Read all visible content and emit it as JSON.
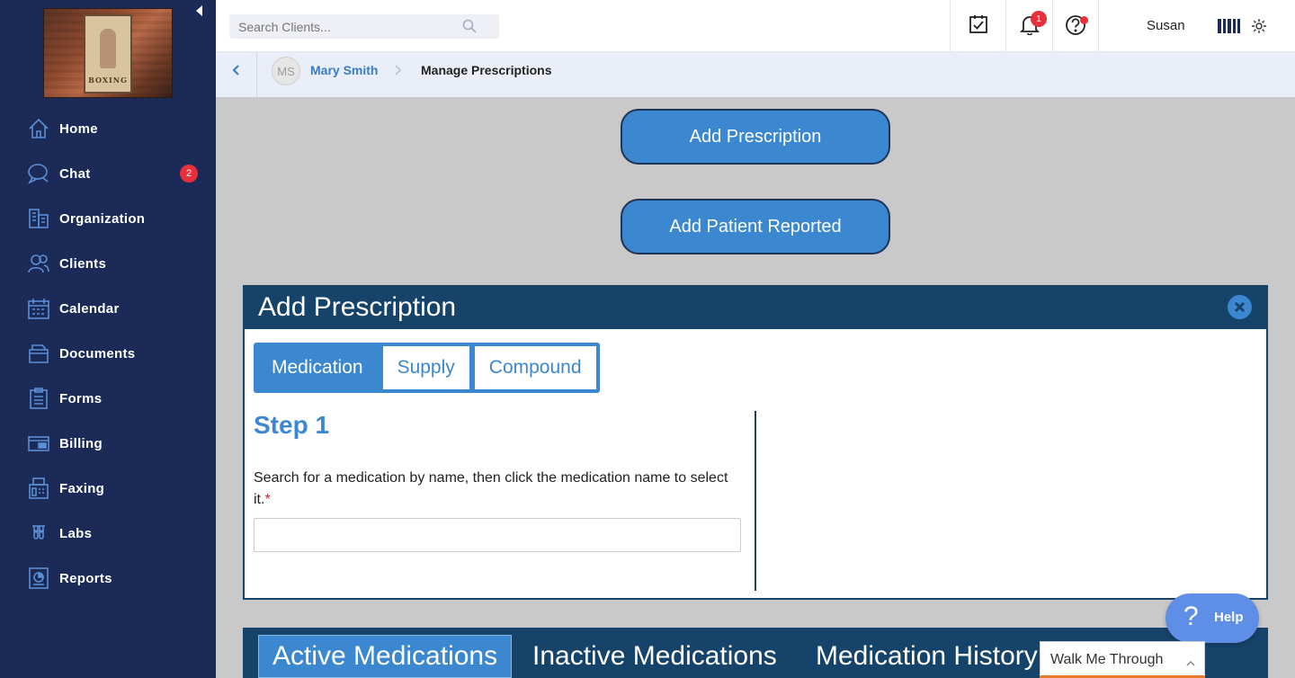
{
  "sidebar": {
    "logo_text": "BOXING",
    "items": [
      {
        "label": "Home",
        "icon": "home-icon"
      },
      {
        "label": "Chat",
        "icon": "chat-icon",
        "badge": "2"
      },
      {
        "label": "Organization",
        "icon": "organization-icon"
      },
      {
        "label": "Clients",
        "icon": "clients-icon"
      },
      {
        "label": "Calendar",
        "icon": "calendar-icon"
      },
      {
        "label": "Documents",
        "icon": "documents-icon"
      },
      {
        "label": "Forms",
        "icon": "forms-icon"
      },
      {
        "label": "Billing",
        "icon": "billing-icon"
      },
      {
        "label": "Faxing",
        "icon": "faxing-icon"
      },
      {
        "label": "Labs",
        "icon": "labs-icon"
      },
      {
        "label": "Reports",
        "icon": "reports-icon"
      }
    ]
  },
  "topbar": {
    "search_placeholder": "Search Clients...",
    "notifications_count": "1",
    "user_name": "Susan"
  },
  "breadcrumb": {
    "avatar_initials": "MS",
    "client_name": "Mary Smith",
    "page": "Manage Prescriptions"
  },
  "actions": {
    "add_prescription": "Add Prescription",
    "add_patient_reported": "Add Patient Reported"
  },
  "modal": {
    "title": "Add Prescription",
    "tabs": [
      "Medication",
      "Supply",
      "Compound"
    ],
    "active_tab": "Medication",
    "step_title": "Step 1",
    "step_description": "Search for a medication by name, then click the medication name to select it.",
    "required_marker": "*",
    "medication_search_value": ""
  },
  "medication_tabs": {
    "items": [
      "Active Medications",
      "Inactive Medications",
      "Medication History"
    ],
    "active": "Active Medications"
  },
  "help": {
    "label": "Help",
    "glyph": "?"
  },
  "walkme": {
    "label": "Walk Me Through"
  },
  "colors": {
    "sidebar_bg": "#1b2a56",
    "accent": "#3b87d0",
    "modal_header": "#16436a",
    "badge": "#e8303a",
    "help_bg": "#5f8ee6",
    "walkme_accent": "#e8792a"
  }
}
